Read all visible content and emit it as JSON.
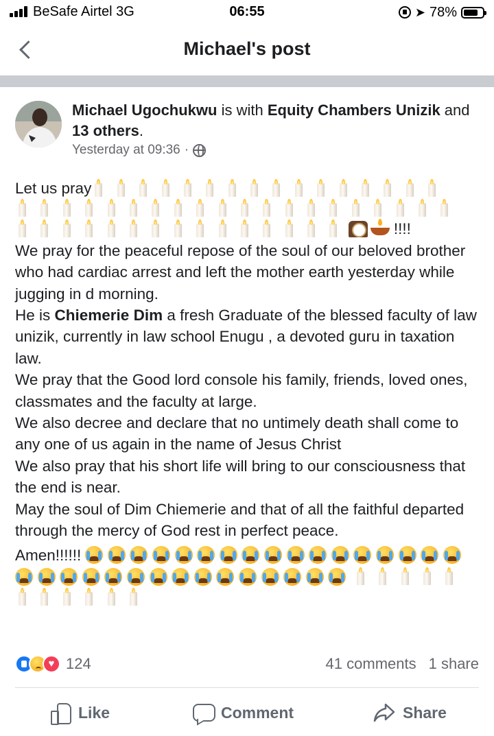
{
  "status_bar": {
    "carrier": "BeSafe Airtel  3G",
    "time": "06:55",
    "battery": "78%",
    "battery_level": 0.78,
    "icons": [
      "signal-icon",
      "rotation-lock-icon",
      "location-icon",
      "battery-icon"
    ]
  },
  "nav": {
    "title": "Michael's post",
    "back_icon": "chevron-left-icon"
  },
  "post": {
    "author": "Michael Ugochukwu",
    "with_text": " is with ",
    "tagged": "Equity Chambers Unizik",
    "and_text": " and ",
    "others": "13 others",
    "period": ".",
    "timestamp": "Yesterday at 09:36",
    "separator": "·",
    "privacy_icon": "globe-icon",
    "text": {
      "intro": "Let us pray",
      "exclaim": "!!!!",
      "p1": "We pray for the peaceful repose of the soul of our beloved brother who had cardiac arrest and left the  mother earth yesterday  while jugging in d morning.",
      "p2_prefix": "He is ",
      "p2_name": "Chiemerie Dim",
      "p2_suffix": " a fresh Graduate of the blessed faculty of law unizik, currently in law school Enugu , a devoted guru in taxation law.",
      "p3": "We pray that the Good lord console his family,  friends, loved ones,  classmates and the faculty at large.",
      "p4": "We also decree and declare that no untimely death  shall come to any one of us again in the name of Jesus  Christ",
      "p5": "We also pray that his short life will bring to our consciousness that the end is near.",
      "p6": "May the soul of Dim Chiemerie and that of all the faithful departed through the mercy of God rest in perfect peace.",
      "amen": "Amen!!!!!! "
    }
  },
  "reactions": {
    "types": [
      "like-icon",
      "sad-icon",
      "love-icon"
    ],
    "count": "124",
    "comments": "41 comments",
    "shares": "1 share"
  },
  "actions": {
    "like": "Like",
    "comment": "Comment",
    "share": "Share"
  }
}
